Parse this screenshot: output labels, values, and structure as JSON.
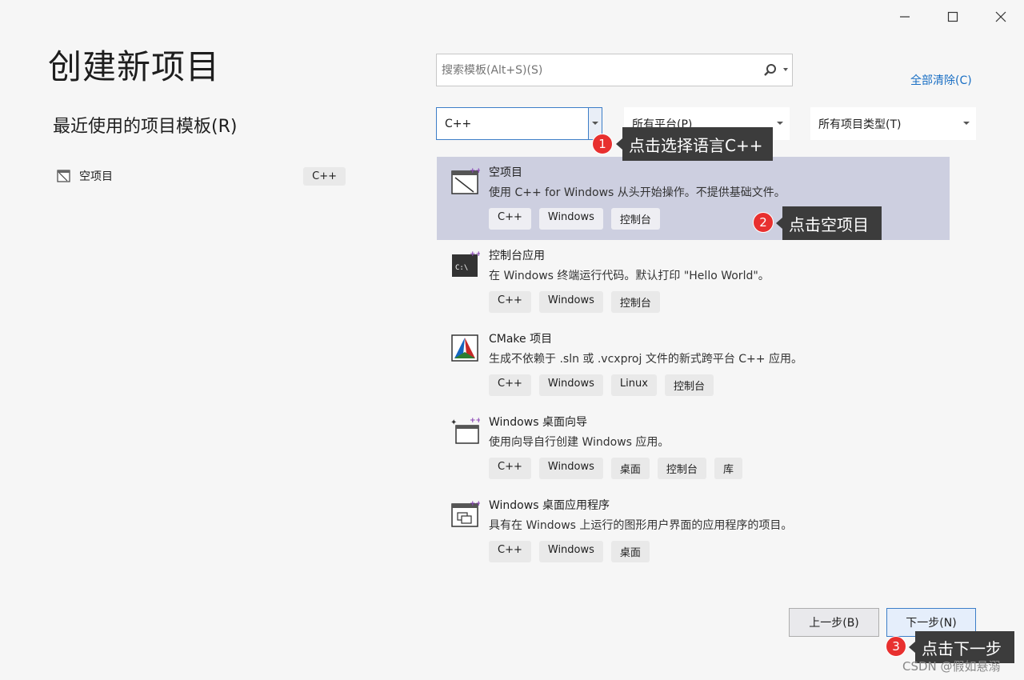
{
  "window": {
    "min_label": "—",
    "max_label": "□",
    "close_label": "×"
  },
  "title": "创建新项目",
  "recent": {
    "heading": "最近使用的项目模板(R)",
    "items": [
      {
        "name": "空项目",
        "tag": "C++",
        "icon": "empty-project-icon"
      }
    ]
  },
  "search": {
    "placeholder": "搜索模板(Alt+S)(S)",
    "value": ""
  },
  "clear_all": "全部清除(C)",
  "filters": {
    "language": "C++",
    "platform": "所有平台(P)",
    "type": "所有项目类型(T)"
  },
  "templates": [
    {
      "name": "空项目",
      "desc": "使用 C++ for Windows 从头开始操作。不提供基础文件。",
      "tags": [
        "C++",
        "Windows",
        "控制台"
      ],
      "icon": "empty-project-icon",
      "selected": true
    },
    {
      "name": "控制台应用",
      "desc": "在 Windows 终端运行代码。默认打印 \"Hello World\"。",
      "tags": [
        "C++",
        "Windows",
        "控制台"
      ],
      "icon": "console-app-icon"
    },
    {
      "name": "CMake 项目",
      "desc": "生成不依赖于 .sln 或 .vcxproj 文件的新式跨平台 C++ 应用。",
      "tags": [
        "C++",
        "Windows",
        "Linux",
        "控制台"
      ],
      "icon": "cmake-icon"
    },
    {
      "name": "Windows 桌面向导",
      "desc": "使用向导自行创建 Windows 应用。",
      "tags": [
        "C++",
        "Windows",
        "桌面",
        "控制台",
        "库"
      ],
      "icon": "desktop-wizard-icon"
    },
    {
      "name": "Windows 桌面应用程序",
      "desc": "具有在 Windows 上运行的图形用户界面的应用程序的项目。",
      "tags": [
        "C++",
        "Windows",
        "桌面"
      ],
      "icon": "desktop-app-icon"
    }
  ],
  "buttons": {
    "back": "上一步(B)",
    "next": "下一步(N)"
  },
  "annotations": [
    {
      "num": "1",
      "text": "点击选择语言C++"
    },
    {
      "num": "2",
      "text": "点击空项目"
    },
    {
      "num": "3",
      "text": "点击下一步"
    }
  ],
  "watermark": "CSDN @假如悬溺",
  "colors": {
    "accent": "#3d7ec8",
    "link": "#1a6fc4",
    "selected_bg": "#cdcfe0",
    "badge": "#e8302f"
  }
}
